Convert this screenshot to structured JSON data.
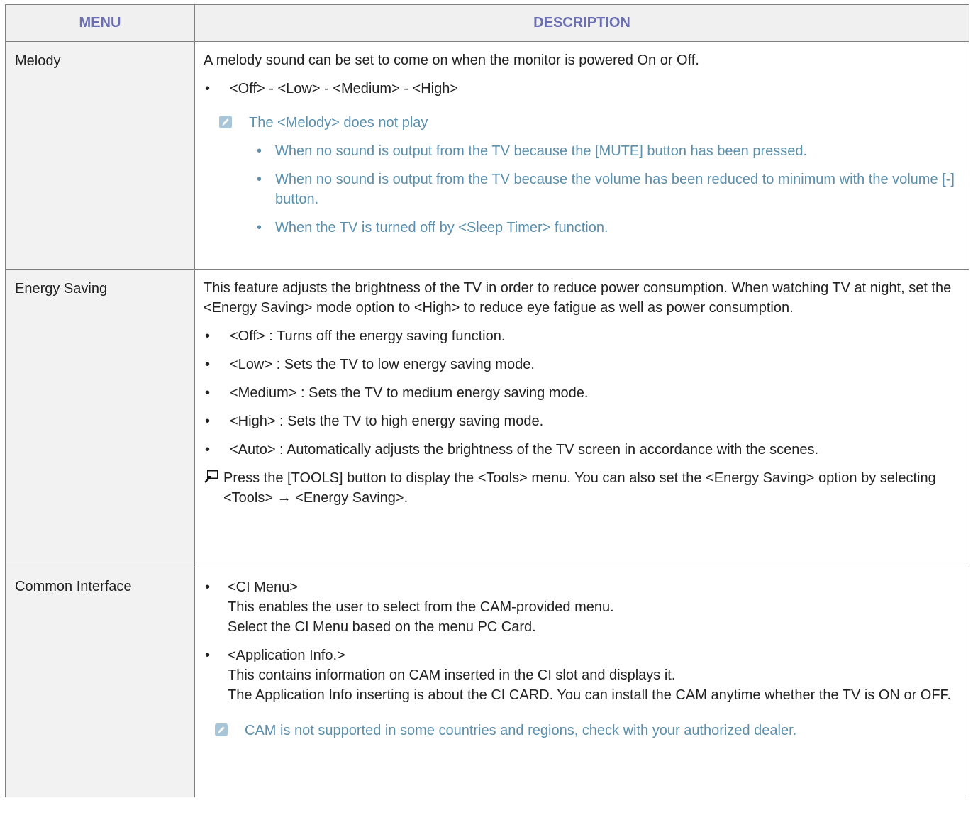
{
  "header": {
    "menu": "MENU",
    "description": "DESCRIPTION"
  },
  "melody": {
    "menu": "Melody",
    "intro": "A melody sound can be set to come on when the monitor is powered On or Off.",
    "options": "<Off> - <Low> - <Medium> - <High>",
    "note_title": "The <Melody> does not play",
    "note_items": [
      "When no sound is output from the TV because the [MUTE] button has been pressed.",
      "When no sound is output from the TV because the volume has been reduced to minimum with the volume [-] button.",
      "When the TV is turned off by <Sleep Timer> function."
    ]
  },
  "energy": {
    "menu": "Energy Saving",
    "intro": "This feature adjusts the brightness of the TV in order to reduce power consumption. When watching TV at night, set the <Energy Saving> mode option to <High> to reduce eye fatigue as well as power consumption.",
    "items": [
      "<Off> : Turns off the energy saving function.",
      "<Low> : Sets the TV to low energy saving mode.",
      "<Medium> : Sets the TV to medium energy saving mode.",
      "<High> : Sets the TV to high energy saving mode.",
      "<Auto> : Automatically adjusts the brightness of the TV screen in accordance with the scenes."
    ],
    "tools": "Press the [TOOLS] button to display the <Tools> menu. You can also set the <Energy Saving> option by selecting <Tools> → <Energy Saving>."
  },
  "ci": {
    "menu": "Common Interface",
    "items": [
      {
        "title": "<CI Menu>",
        "lines": [
          "This enables the user to select from the CAM-provided menu.",
          "Select the CI Menu based on the menu PC Card."
        ]
      },
      {
        "title": "<Application Info.>",
        "lines": [
          "This contains information on CAM inserted in the CI slot and displays it.",
          "The Application Info inserting is about the CI CARD. You can install the CAM anytime whether the TV is ON or OFF."
        ]
      }
    ],
    "note": "CAM is not supported in some countries and regions, check with your authorized dealer."
  },
  "bullet": "•",
  "icons": {
    "note": "note-pencil-icon",
    "tools": "tools-remote-icon"
  },
  "colors": {
    "header_text": "#6b6fb0",
    "note_text": "#5a8fae",
    "header_bg": "#f0f0f0",
    "menu_bg": "#f2f2f2"
  }
}
